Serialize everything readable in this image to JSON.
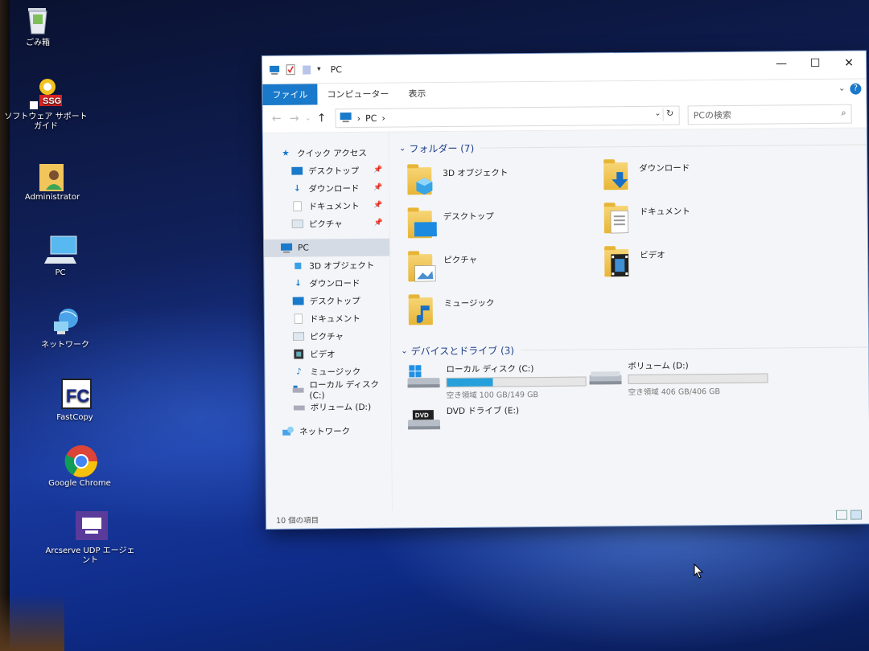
{
  "desktop": {
    "icons": [
      {
        "label": "ごみ箱",
        "icon": "recycle-bin-icon"
      },
      {
        "label": "ソフトウェア サポート ガイド",
        "icon": "ssg-icon",
        "badge": "SSG"
      },
      {
        "label": "Administrator",
        "icon": "user-folder-icon"
      },
      {
        "label": "PC",
        "icon": "pc-icon"
      },
      {
        "label": "ネットワーク",
        "icon": "network-icon"
      },
      {
        "label": "FastCopy",
        "icon": "fastcopy-icon",
        "badge": "FC"
      },
      {
        "label": "Google Chrome",
        "icon": "chrome-icon"
      },
      {
        "label": "Arcserve UDP エージェント",
        "icon": "arcserve-icon"
      }
    ]
  },
  "window": {
    "title": "PC",
    "controls": {
      "minimize": "—",
      "maximize": "☐",
      "close": "✕"
    },
    "ribbon": {
      "tabs": [
        "ファイル",
        "コンピューター",
        "表示"
      ],
      "active": "ファイル",
      "help": "?",
      "collapse": "⌄"
    },
    "address": {
      "back": "←",
      "forward": "→",
      "recent": "⌄",
      "up": "↑",
      "path": "PC",
      "sep": "›"
    },
    "search": {
      "placeholder": "PCの検索",
      "icon": "⌕"
    },
    "nav": {
      "quick_access": "クイック アクセス",
      "quick_items": [
        "デスクトップ",
        "ダウンロード",
        "ドキュメント",
        "ピクチャ"
      ],
      "pc": "PC",
      "pc_items": [
        "3D オブジェクト",
        "ダウンロード",
        "デスクトップ",
        "ドキュメント",
        "ピクチャ",
        "ビデオ",
        "ミュージック",
        "ローカル ディスク (C:)",
        "ボリューム (D:)"
      ],
      "network": "ネットワーク"
    },
    "folders_header": "フォルダー (7)",
    "folders": [
      "3D オブジェクト",
      "ダウンロード",
      "デスクトップ",
      "ドキュメント",
      "ピクチャ",
      "ビデオ",
      "ミュージック"
    ],
    "drives_header": "デバイスとドライブ (3)",
    "drives": [
      {
        "name": "ローカル ディスク (C:)",
        "free": "空き領域 100 GB/149 GB",
        "used_fraction": 0.33
      },
      {
        "name": "ボリューム (D:)",
        "free": "空き領域 406 GB/406 GB",
        "used_fraction": 0.0
      },
      {
        "name": "DVD ドライブ (E:)",
        "badge": "DVD"
      }
    ],
    "status": "10 個の項目"
  },
  "colors": {
    "accent": "#1979ca",
    "bar_fill": "#26a0da",
    "group_text": "#1e3f8a"
  }
}
